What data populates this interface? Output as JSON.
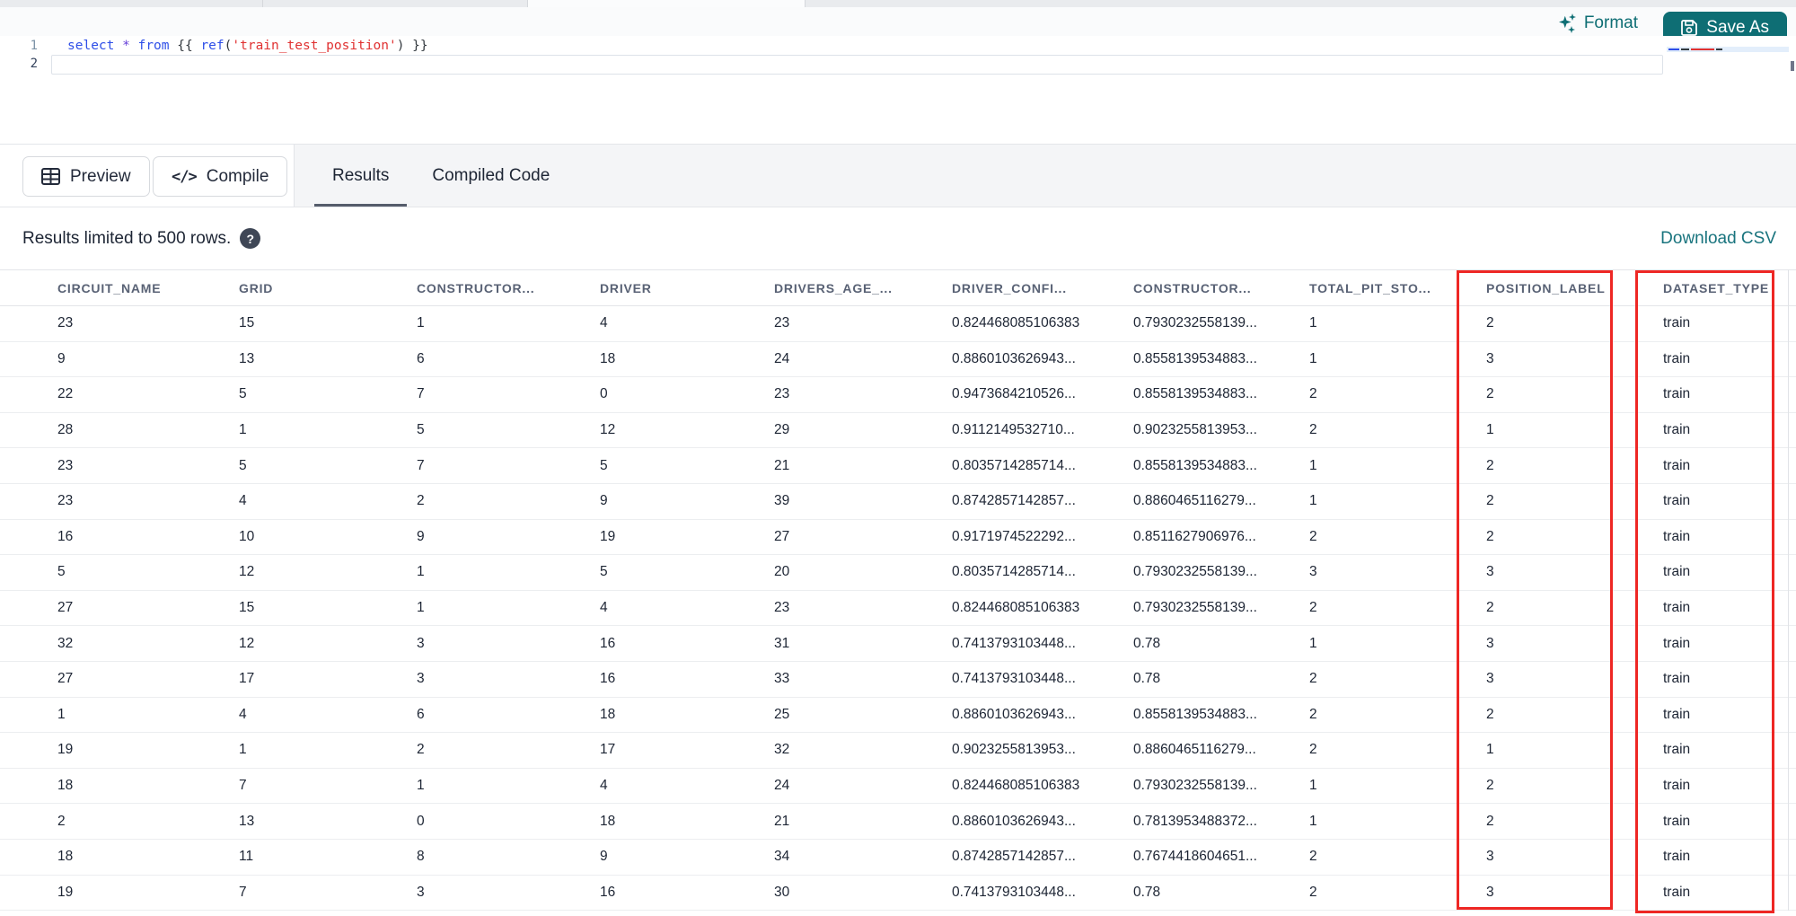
{
  "toolbar": {
    "format_label": "Format",
    "save_as_label": "Save As",
    "preview_label": "Preview",
    "compile_label": "Compile",
    "compile_glyph": "</>"
  },
  "editor": {
    "line_numbers": [
      "1",
      "2"
    ],
    "code_line": "select * from {{ ref('train_test_position') }}",
    "tokens": [
      {
        "t": "select",
        "c": "kw"
      },
      {
        "t": " ",
        "c": "plain"
      },
      {
        "t": "*",
        "c": "op"
      },
      {
        "t": " ",
        "c": "plain"
      },
      {
        "t": "from",
        "c": "kw"
      },
      {
        "t": " ",
        "c": "plain"
      },
      {
        "t": "{{ ",
        "c": "plain"
      },
      {
        "t": "ref",
        "c": "fn"
      },
      {
        "t": "(",
        "c": "plain"
      },
      {
        "t": "'train_test_position'",
        "c": "str"
      },
      {
        "t": ")",
        "c": "plain"
      },
      {
        "t": " }}",
        "c": "plain"
      }
    ]
  },
  "tabs": [
    {
      "label": "Results",
      "active": true
    },
    {
      "label": "Compiled Code",
      "active": false
    }
  ],
  "results": {
    "limit_text": "Results limited to 500 rows.",
    "help_glyph": "?",
    "download_label": "Download CSV"
  },
  "table": {
    "headers": [
      "CIRCUIT_NAME",
      "GRID",
      "CONSTRUCTOR...",
      "DRIVER",
      "DRIVERS_AGE_...",
      "DRIVER_CONFI...",
      "CONSTRUCTOR...",
      "TOTAL_PIT_STO...",
      "POSITION_LABEL",
      "DATASET_TYPE"
    ],
    "rows": [
      [
        "23",
        "15",
        "1",
        "4",
        "23",
        "0.824468085106383",
        "0.7930232558139...",
        "1",
        "2",
        "train"
      ],
      [
        "9",
        "13",
        "6",
        "18",
        "24",
        "0.8860103626943...",
        "0.8558139534883...",
        "1",
        "3",
        "train"
      ],
      [
        "22",
        "5",
        "7",
        "0",
        "23",
        "0.9473684210526...",
        "0.8558139534883...",
        "2",
        "2",
        "train"
      ],
      [
        "28",
        "1",
        "5",
        "12",
        "29",
        "0.9112149532710...",
        "0.9023255813953...",
        "2",
        "1",
        "train"
      ],
      [
        "23",
        "5",
        "7",
        "5",
        "21",
        "0.8035714285714...",
        "0.8558139534883...",
        "1",
        "2",
        "train"
      ],
      [
        "23",
        "4",
        "2",
        "9",
        "39",
        "0.8742857142857...",
        "0.8860465116279...",
        "1",
        "2",
        "train"
      ],
      [
        "16",
        "10",
        "9",
        "19",
        "27",
        "0.9171974522292...",
        "0.8511627906976...",
        "2",
        "2",
        "train"
      ],
      [
        "5",
        "12",
        "1",
        "5",
        "20",
        "0.8035714285714...",
        "0.7930232558139...",
        "3",
        "3",
        "train"
      ],
      [
        "27",
        "15",
        "1",
        "4",
        "23",
        "0.824468085106383",
        "0.7930232558139...",
        "2",
        "2",
        "train"
      ],
      [
        "32",
        "12",
        "3",
        "16",
        "31",
        "0.7413793103448...",
        "0.78",
        "1",
        "3",
        "train"
      ],
      [
        "27",
        "17",
        "3",
        "16",
        "33",
        "0.7413793103448...",
        "0.78",
        "2",
        "3",
        "train"
      ],
      [
        "1",
        "4",
        "6",
        "18",
        "25",
        "0.8860103626943...",
        "0.8558139534883...",
        "2",
        "2",
        "train"
      ],
      [
        "19",
        "1",
        "2",
        "17",
        "32",
        "0.9023255813953...",
        "0.8860465116279...",
        "2",
        "1",
        "train"
      ],
      [
        "18",
        "7",
        "1",
        "4",
        "24",
        "0.824468085106383",
        "0.7930232558139...",
        "1",
        "2",
        "train"
      ],
      [
        "2",
        "13",
        "0",
        "18",
        "21",
        "0.8860103626943...",
        "0.7813953488372...",
        "1",
        "2",
        "train"
      ],
      [
        "18",
        "11",
        "8",
        "9",
        "34",
        "0.8742857142857...",
        "0.7674418604651...",
        "2",
        "3",
        "train"
      ],
      [
        "19",
        "7",
        "3",
        "16",
        "30",
        "0.7413793103448...",
        "0.78",
        "2",
        "3",
        "train"
      ]
    ],
    "highlighted_columns": [
      "POSITION_LABEL",
      "DATASET_TYPE"
    ]
  },
  "colors": {
    "accent_teal": "#0e6e74",
    "link_teal": "#19747e",
    "highlight_red": "#ee2724",
    "keyword_blue": "#2e4fe8",
    "string_red": "#e03131"
  }
}
